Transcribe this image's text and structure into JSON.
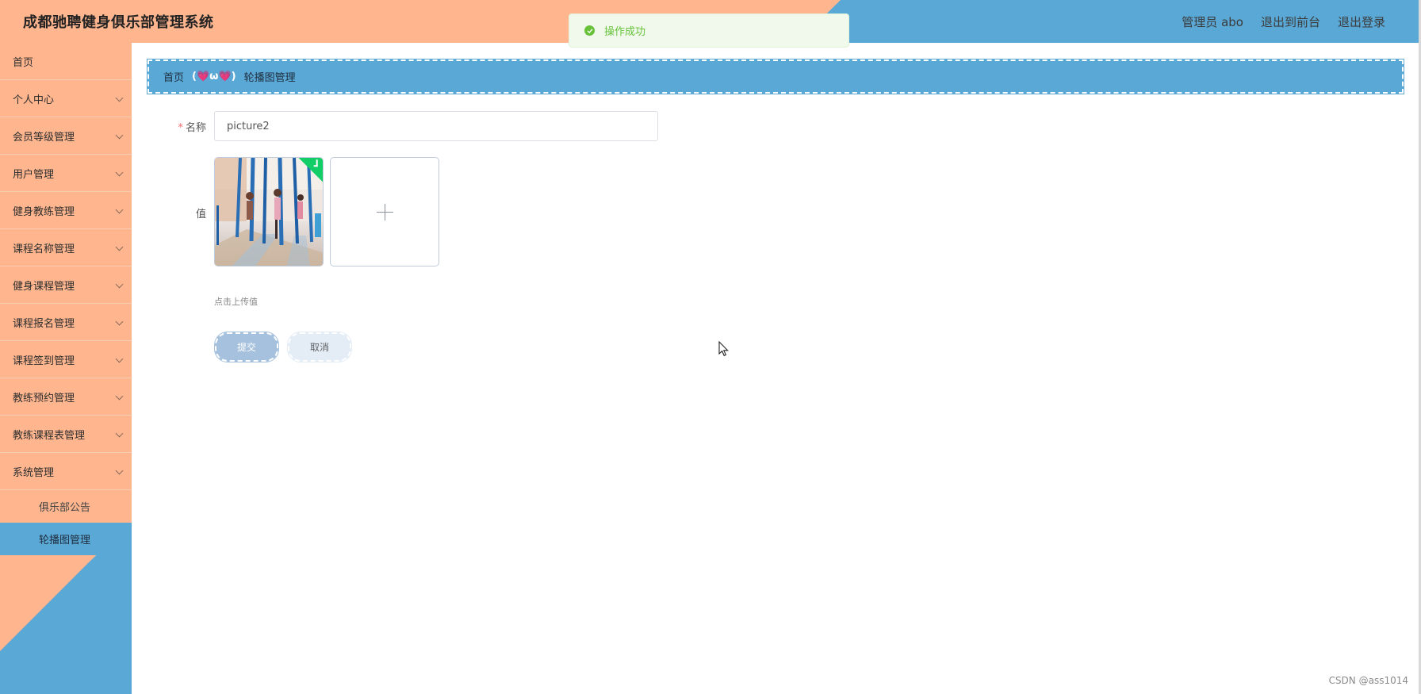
{
  "header": {
    "title": "成都驰聘健身俱乐部管理系统",
    "admin_label": "管理员 abo",
    "back_front": "退出到前台",
    "logout": "退出登录",
    "colors": {
      "left": "#ffb68f",
      "right": "#5aa8d6"
    }
  },
  "toast": {
    "icon": "check-circle-icon",
    "message": "操作成功"
  },
  "sidebar": {
    "items": [
      {
        "label": "首页",
        "has_children": false
      },
      {
        "label": "个人中心",
        "has_children": true
      },
      {
        "label": "会员等级管理",
        "has_children": true
      },
      {
        "label": "用户管理",
        "has_children": true
      },
      {
        "label": "健身教练管理",
        "has_children": true
      },
      {
        "label": "课程名称管理",
        "has_children": true
      },
      {
        "label": "健身课程管理",
        "has_children": true
      },
      {
        "label": "课程报名管理",
        "has_children": true
      },
      {
        "label": "课程签到管理",
        "has_children": true
      },
      {
        "label": "教练预约管理",
        "has_children": true
      },
      {
        "label": "教练课程表管理",
        "has_children": true
      },
      {
        "label": "系统管理",
        "has_children": true
      }
    ],
    "subitems": [
      {
        "label": "俱乐部公告",
        "active": false
      },
      {
        "label": "轮播图管理",
        "active": true
      }
    ]
  },
  "breadcrumb": {
    "home": "首页",
    "separator": "(💗ω💗)",
    "current": "轮播图管理"
  },
  "form": {
    "name_label": "名称",
    "name_value": "picture2",
    "value_label": "值",
    "upload_hint": "点击上传值",
    "submit_label": "提交",
    "cancel_label": "取消"
  },
  "watermark": "CSDN @ass1014"
}
